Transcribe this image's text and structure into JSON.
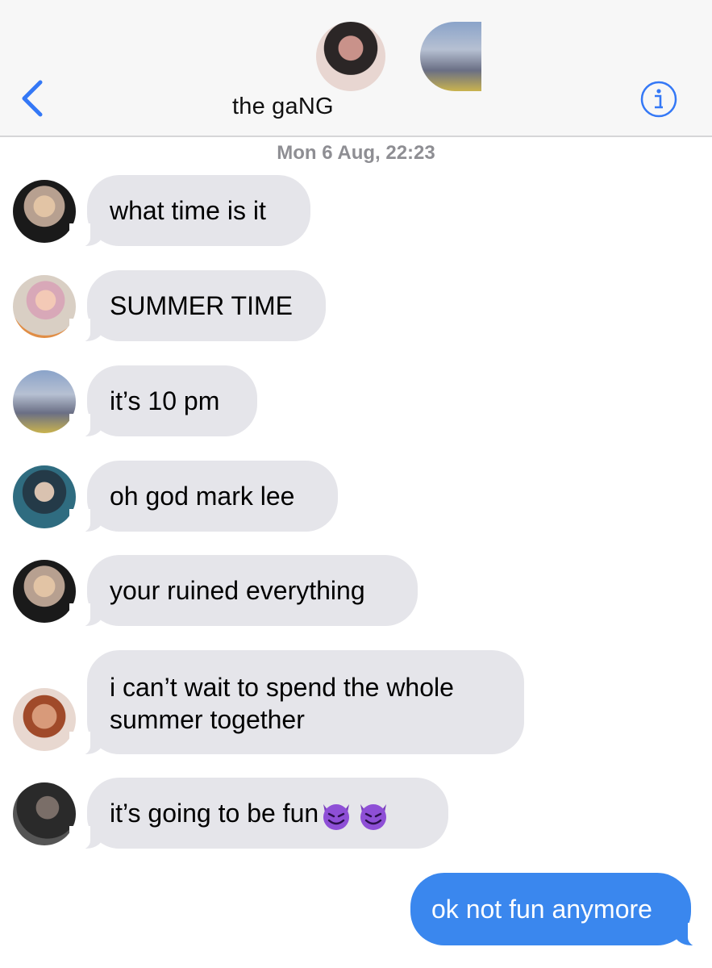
{
  "header": {
    "title": "the gaNG",
    "back_icon": "chevron-left-icon",
    "info_icon": "info-icon",
    "accent_color": "#3478f6"
  },
  "timestamp": {
    "day": "Mon 6 Aug,",
    "time": "22:23"
  },
  "messages": [
    {
      "text": "what time is it",
      "direction": "incoming"
    },
    {
      "text": "SUMMER TIME",
      "direction": "incoming"
    },
    {
      "text": "it’s 10 pm",
      "direction": "incoming"
    },
    {
      "text": "oh god mark lee",
      "direction": "incoming"
    },
    {
      "text": "your ruined everything",
      "direction": "incoming"
    },
    {
      "text_line1": "i can’t wait to spend the whole",
      "text_line2": "summer together",
      "direction": "incoming"
    },
    {
      "text": "it’s going to be fun",
      "emoji": "smiling-devil-emoji",
      "direction": "incoming"
    },
    {
      "text": "ok not fun anymore",
      "direction": "outgoing"
    }
  ],
  "colors": {
    "incoming_bubble": "#e5e5ea",
    "outgoing_bubble": "#3a87ee",
    "timestamp_text": "#8e8e93"
  }
}
